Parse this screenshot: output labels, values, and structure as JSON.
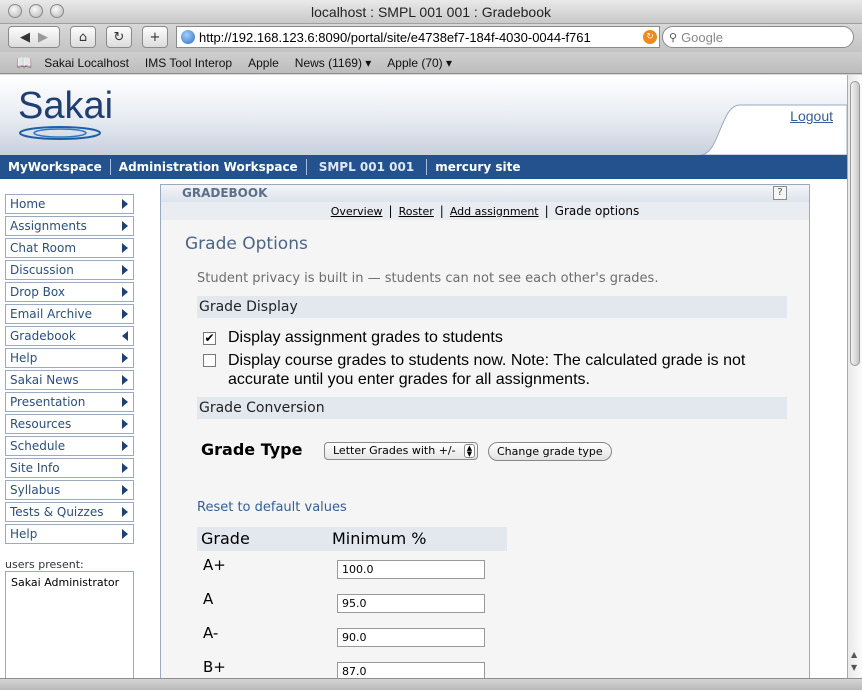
{
  "window": {
    "title": "localhost : SMPL 001 001 : Gradebook"
  },
  "browser": {
    "url": "http://192.168.123.6:8090/portal/site/e4738ef7-184f-4030-0044-f761",
    "search_placeholder": "Google",
    "bookmarks": [
      "Sakai Localhost",
      "IMS Tool Interop",
      "Apple",
      "News (1169) ▾",
      "Apple (70) ▾"
    ]
  },
  "header": {
    "logo": "Sakai",
    "logout": "Logout"
  },
  "sites": [
    "MyWorkspace",
    "Administration Workspace",
    "SMPL 001 001",
    "mercury site"
  ],
  "sidebar": {
    "tools": [
      "Home",
      "Assignments",
      "Chat Room",
      "Discussion",
      "Drop Box",
      "Email Archive",
      "Gradebook",
      "Help",
      "Sakai News",
      "Presentation",
      "Resources",
      "Schedule",
      "Site Info",
      "Syllabus",
      "Tests & Quizzes",
      "Help"
    ],
    "users_label": "users present:",
    "users": [
      "Sakai Administrator"
    ]
  },
  "gradebook": {
    "title": "GRADEBOOK",
    "help": "?",
    "menu": {
      "overview": "Overview",
      "roster": "Roster",
      "add": "Add assignment",
      "current": "Grade options"
    },
    "heading": "Grade Options",
    "privacy": "Student privacy is built in — students can not see each other's grades.",
    "display_section": "Grade Display",
    "option1": "Display assignment grades to students",
    "option1_checked": true,
    "option2": "Display course grades to students now. Note: The calculated grade is not accurate until you enter grades for all assignments.",
    "option2_checked": false,
    "conversion_section": "Grade Conversion",
    "grade_type_label": "Grade Type",
    "grade_type_value": "Letter Grades with +/-",
    "change_button": "Change grade type",
    "reset": "Reset to default values",
    "col_grade": "Grade",
    "col_min": "Minimum %",
    "rows": [
      {
        "grade": "A+",
        "min": "100.0"
      },
      {
        "grade": "A",
        "min": "95.0"
      },
      {
        "grade": "A-",
        "min": "90.0"
      },
      {
        "grade": "B+",
        "min": "87.0"
      }
    ]
  }
}
